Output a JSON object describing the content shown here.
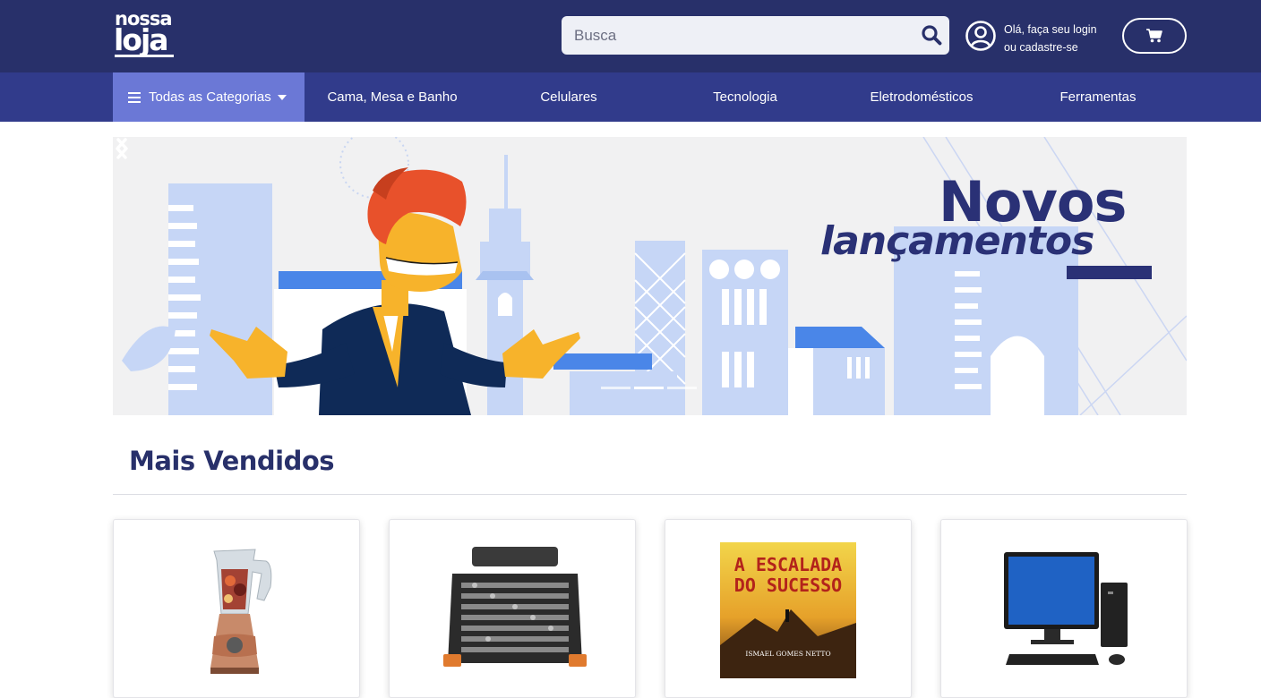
{
  "header": {
    "logo_line1": "nossa",
    "logo_line2": "loja",
    "search_placeholder": "Busca",
    "account_line1": "Olá, faça seu login",
    "account_line2": "ou cadastre-se",
    "icons": {
      "search": "search-icon",
      "account": "user-circle-icon",
      "cart": "shopping-cart-icon"
    },
    "colors": {
      "topbar": "#28306a",
      "navbar": "#313b8b",
      "all_categories": "#6b78d6"
    }
  },
  "nav": {
    "all_categories": "Todas as Categorias",
    "items": [
      {
        "label": "Cama, Mesa e Banho"
      },
      {
        "label": "Celulares"
      },
      {
        "label": "Tecnologia"
      },
      {
        "label": "Eletrodomésticos"
      },
      {
        "label": "Ferramentas"
      }
    ]
  },
  "banner": {
    "title_line1": "Novos",
    "title_line2": "lançamentos",
    "slides": 3,
    "active_slide": 2
  },
  "section": {
    "title": "Mais Vendidos"
  },
  "products": [
    {
      "image": "blender-image"
    },
    {
      "image": "toolbox-image"
    },
    {
      "image": "book-cover-image",
      "book_title_line1": "A ESCALADA",
      "book_title_line2": "DO SUCESSO",
      "book_author": "ISMAEL GOMES NETTO"
    },
    {
      "image": "desktop-computer-image"
    }
  ]
}
